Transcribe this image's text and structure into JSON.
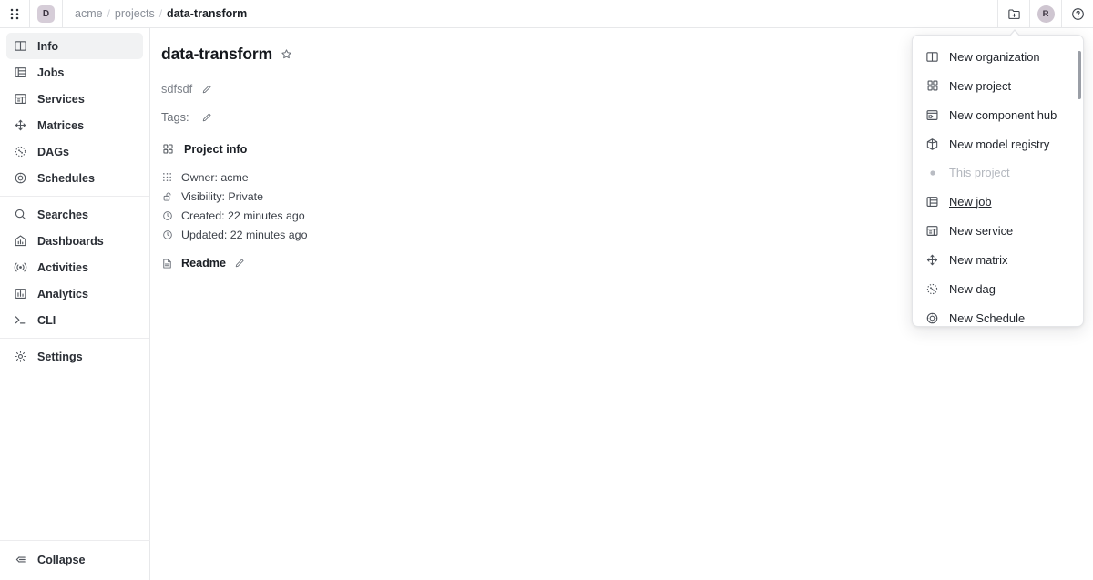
{
  "topbar": {
    "grip_icon": "grid-grip-icon",
    "org_initial": "D",
    "breadcrumb": {
      "org": "acme",
      "section": "projects",
      "current": "data-transform",
      "separator": "/"
    },
    "new_folder_icon": "new-folder-icon",
    "avatar_initial": "R",
    "help_icon": "question-circle-icon"
  },
  "sidebar": {
    "groups": [
      {
        "items": [
          {
            "label": "Info",
            "icon": "panels-icon",
            "active": true
          },
          {
            "label": "Jobs",
            "icon": "table-icon",
            "active": false
          },
          {
            "label": "Services",
            "icon": "service-layout-icon",
            "active": false
          },
          {
            "label": "Matrices",
            "icon": "matrix-icon",
            "active": false
          },
          {
            "label": "DAGs",
            "icon": "dag-dotted-circle-icon",
            "active": false
          },
          {
            "label": "Schedules",
            "icon": "schedule-target-icon",
            "active": false
          }
        ]
      },
      {
        "items": [
          {
            "label": "Searches",
            "icon": "search-icon",
            "active": false
          },
          {
            "label": "Dashboards",
            "icon": "dashboard-chart-icon",
            "active": false
          },
          {
            "label": "Activities",
            "icon": "broadcast-icon",
            "active": false
          },
          {
            "label": "Analytics",
            "icon": "analytics-bars-icon",
            "active": false
          },
          {
            "label": "CLI",
            "icon": "terminal-icon",
            "active": false
          }
        ]
      },
      {
        "items": [
          {
            "label": "Settings",
            "icon": "gear-icon",
            "active": false
          }
        ]
      }
    ],
    "collapse": {
      "label": "Collapse",
      "icon": "collapse-left-icon"
    }
  },
  "main": {
    "project_title": "data-transform",
    "star_icon": "star-outline-icon",
    "description": "sdfsdf",
    "description_edit_icon": "pencil-icon",
    "tags_label": "Tags:",
    "tags_edit_icon": "pencil-icon",
    "project_info": {
      "heading": "Project info",
      "heading_icon": "grid-squares-icon",
      "rows": [
        {
          "icon": "dots-grid-icon",
          "text": "Owner: acme"
        },
        {
          "icon": "unlock-icon",
          "text": "Visibility: Private"
        },
        {
          "icon": "clock-icon",
          "text": "Created: 22 minutes ago"
        },
        {
          "icon": "clock-icon",
          "text": "Updated: 22 minutes ago"
        }
      ]
    },
    "readme": {
      "label": "Readme",
      "icon": "document-icon",
      "edit_icon": "pencil-icon"
    }
  },
  "menu": {
    "items": [
      {
        "label": "New organization",
        "icon": "panels-icon",
        "type": "item",
        "hovered": false
      },
      {
        "label": "New project",
        "icon": "grid-squares-icon",
        "type": "item",
        "hovered": false
      },
      {
        "label": "New component hub",
        "icon": "component-hub-icon",
        "type": "item",
        "hovered": false
      },
      {
        "label": "New model registry",
        "icon": "model-registry-icon",
        "type": "item",
        "hovered": false
      },
      {
        "label": "This project",
        "icon": "dot-icon",
        "type": "section",
        "hovered": false
      },
      {
        "label": "New job",
        "icon": "table-icon",
        "type": "item",
        "hovered": true
      },
      {
        "label": "New service",
        "icon": "service-layout-icon",
        "type": "item",
        "hovered": false
      },
      {
        "label": "New matrix",
        "icon": "matrix-icon",
        "type": "item",
        "hovered": false
      },
      {
        "label": "New dag",
        "icon": "dag-dotted-circle-icon",
        "type": "item",
        "hovered": false
      },
      {
        "label": "New Schedule",
        "icon": "schedule-target-icon",
        "type": "item",
        "hovered": false
      }
    ]
  },
  "colors": {
    "border": "#e7e8ea",
    "active_bg": "#f1f2f3",
    "avatar_bg": "#cfc6d1",
    "org_chip_bg": "#d6cdd8",
    "muted_text": "#8a8f98"
  }
}
